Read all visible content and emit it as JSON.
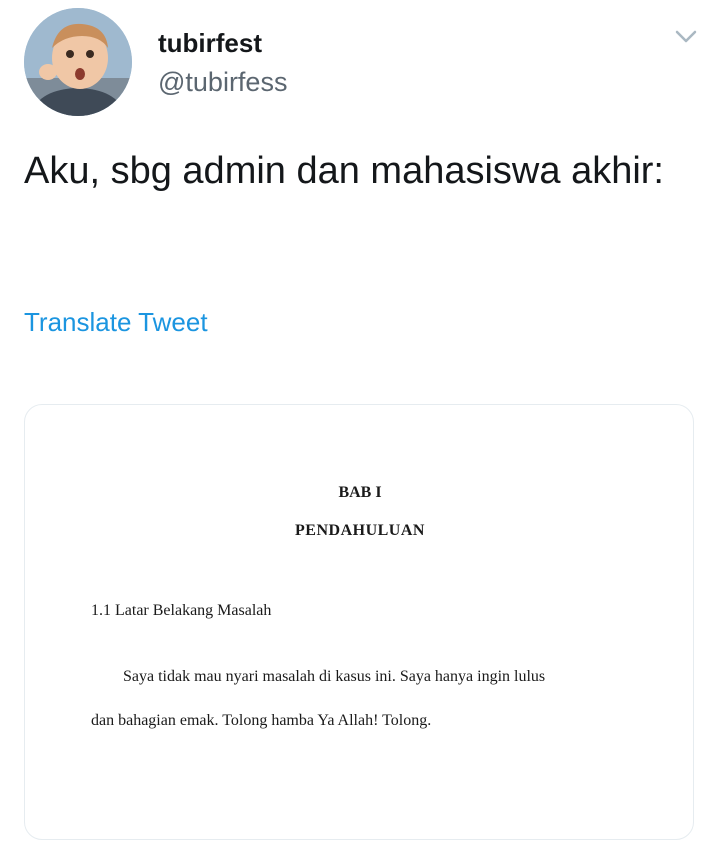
{
  "user": {
    "display_name": "tubirfest",
    "handle": "@tubirfess"
  },
  "tweet": {
    "text": "Aku, sbg admin dan mahasiswa akhir:",
    "translate_label": "Translate Tweet"
  },
  "icons": {
    "menu": "chevron-down-icon",
    "avatar": "avatar-photo"
  },
  "colors": {
    "link": "#1b95e0",
    "handle": "#5b6670",
    "card_border": "#e6ecf0"
  },
  "document": {
    "chapter": "BAB I",
    "title": "PENDAHULUAN",
    "section": "1.1 Latar Belakang Masalah",
    "paragraph_line1": "Saya tidak mau nyari masalah di kasus ini. Saya hanya ingin lulus",
    "paragraph_line2": "dan bahagian emak. Tolong hamba Ya Allah! Tolong."
  }
}
